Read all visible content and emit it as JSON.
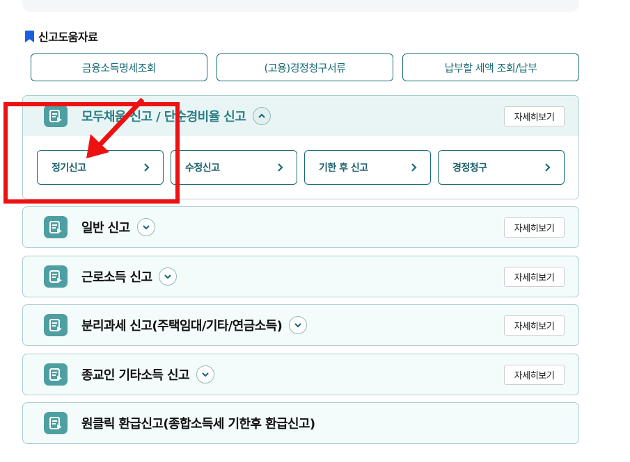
{
  "section": {
    "title": "신고도움자료",
    "icon": "bookmark-icon",
    "buttons": [
      "금융소득명세조회",
      "(고용)경정청구서류",
      "납부할 세액 조회/납부"
    ]
  },
  "accordions": [
    {
      "title": "모두채움 신고 / 단순경비율 신고",
      "expanded": true,
      "detail_label": "자세히보기",
      "sub_items": [
        "정기신고",
        "수정신고",
        "기한 후 신고",
        "경정청구"
      ]
    },
    {
      "title": "일반 신고",
      "expanded": false,
      "detail_label": "자세히보기"
    },
    {
      "title": "근로소득 신고",
      "expanded": false,
      "detail_label": "자세히보기"
    },
    {
      "title": "분리과세 신고(주택임대/기타/연금소득)",
      "expanded": false,
      "detail_label": "자세히보기"
    },
    {
      "title": "종교인 기타소득 신고",
      "expanded": false,
      "detail_label": "자세히보기"
    },
    {
      "title": "원클릭 환급신고(종합소득세 기한후 환급신고)"
    }
  ],
  "colors": {
    "accent": "#1a6b78",
    "icon_bg": "#4e9fa2",
    "highlight": "#ee1111"
  }
}
